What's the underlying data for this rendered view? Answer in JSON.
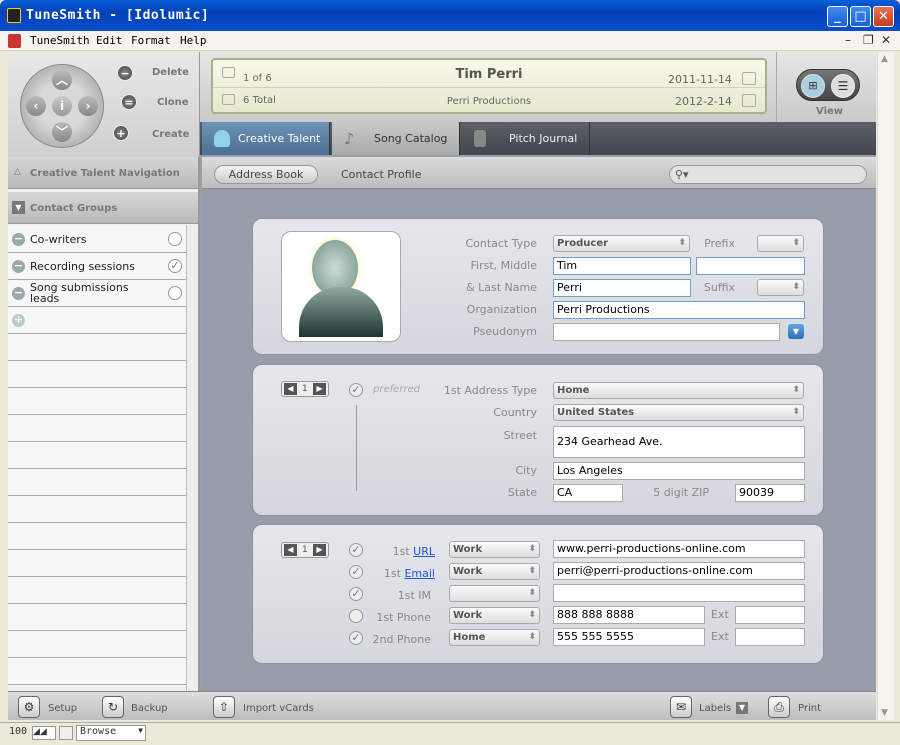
{
  "window": {
    "title": "TuneSmith - [Idolumic]"
  },
  "menu": {
    "items": [
      "TuneSmith",
      "Edit",
      "Format",
      "Help"
    ]
  },
  "toolbar": {
    "delete": "Delete",
    "clone": "Clone",
    "create": "Create",
    "view": "View"
  },
  "record": {
    "position": "1 of 6",
    "total": "6 Total",
    "name": "Tim Perri",
    "company": "Perri Productions",
    "created": "2011-11-14",
    "modified": "2012-2-14"
  },
  "tabs": [
    "Creative Talent",
    "Song Catalog",
    "Pitch Journal"
  ],
  "sidebar": {
    "nav_header": "Creative Talent Navigation",
    "groups_header": "Contact Groups",
    "groups": [
      {
        "label": "Co-writers",
        "checked": false
      },
      {
        "label": "Recording sessions",
        "checked": true
      },
      {
        "label": "Song submissions leads",
        "checked": false
      }
    ]
  },
  "subnav": {
    "address_book": "Address Book",
    "contact_profile": "Contact Profile",
    "search_placeholder": ""
  },
  "contact": {
    "labels": {
      "contact_type": "Contact Type",
      "prefix": "Prefix",
      "first_middle": "First, Middle",
      "last_name": "& Last Name",
      "suffix": "Suffix",
      "organization": "Organization",
      "pseudonym": "Pseudonym"
    },
    "contact_type": "Producer",
    "first": "Tim",
    "middle": "",
    "last": "Perri",
    "organization": "Perri Productions",
    "pseudonym": ""
  },
  "address": {
    "page": "1",
    "preferred": "preferred",
    "labels": {
      "type": "1st Address Type",
      "country": "Country",
      "street": "Street",
      "city": "City",
      "state": "State",
      "zip": "5 digit ZIP"
    },
    "type": "Home",
    "country": "United States",
    "street": "234 Gearhead Ave.",
    "city": "Los Angeles",
    "state": "CA",
    "zip": "90039"
  },
  "comm": {
    "page": "1",
    "rows": [
      {
        "prefix": "1st",
        "link": "URL",
        "type": "Work",
        "value": "www.perri-productions-online.com",
        "checked": true
      },
      {
        "prefix": "1st",
        "link": "Email",
        "type": "Work",
        "value": "perri@perri-productions-online.com",
        "checked": true
      },
      {
        "prefix": "1st IM",
        "link": "",
        "type": "",
        "value": "",
        "checked": true
      },
      {
        "prefix": "1st Phone",
        "link": "",
        "type": "Work",
        "value": "888 888 8888",
        "checked": false
      },
      {
        "prefix": "2nd Phone",
        "link": "",
        "type": "Home",
        "value": "555 555 5555",
        "checked": true
      }
    ],
    "ext_label": "Ext"
  },
  "bottom": {
    "setup": "Setup",
    "backup": "Backup",
    "import": "Import vCards",
    "labels": "Labels",
    "print": "Print"
  },
  "status": {
    "zoom": "100",
    "mode": "Browse"
  }
}
